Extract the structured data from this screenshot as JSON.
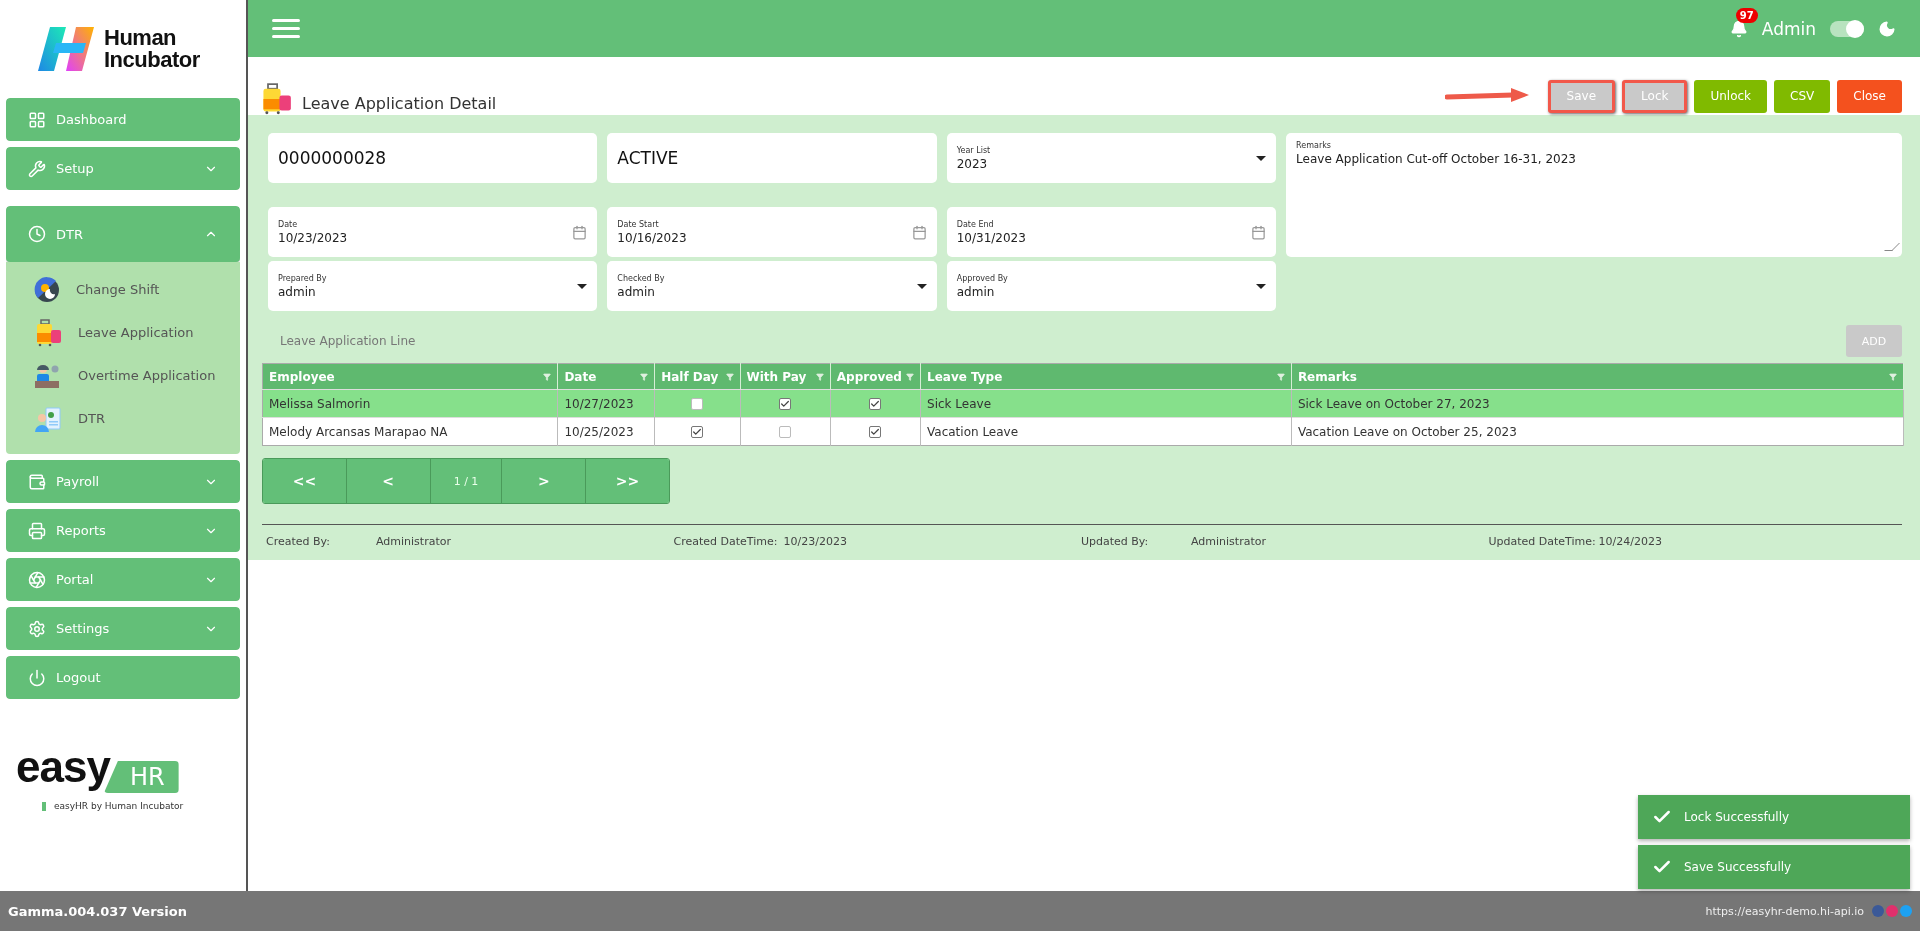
{
  "brand": {
    "line1": "Human",
    "line2": "Incubator"
  },
  "sidebar": {
    "items": [
      {
        "label": "Dashboard",
        "kind": "link"
      },
      {
        "label": "Setup",
        "kind": "group",
        "expanded": false
      },
      {
        "label": "DTR",
        "kind": "group",
        "expanded": true,
        "children": [
          {
            "label": "Change Shift"
          },
          {
            "label": "Leave Application"
          },
          {
            "label": "Overtime Application"
          },
          {
            "label": "DTR"
          }
        ]
      },
      {
        "label": "Payroll",
        "kind": "group",
        "expanded": false
      },
      {
        "label": "Reports",
        "kind": "group",
        "expanded": false
      },
      {
        "label": "Portal",
        "kind": "group",
        "expanded": false
      },
      {
        "label": "Settings",
        "kind": "group",
        "expanded": false
      },
      {
        "label": "Logout",
        "kind": "link"
      }
    ]
  },
  "footer_logo": {
    "word": "easy",
    "badge": "HR",
    "tagline": "easyHR by Human Incubator"
  },
  "header": {
    "notifications": "97",
    "user": "Admin",
    "theme_toggle": {
      "on": true
    }
  },
  "page": {
    "title": "Leave Application Detail",
    "buttons": [
      {
        "label": "Save",
        "kind": "neutral",
        "highlighted": true
      },
      {
        "label": "Lock",
        "kind": "neutral",
        "highlighted": true
      },
      {
        "label": "Unlock",
        "kind": "success",
        "highlighted": false
      },
      {
        "label": "CSV",
        "kind": "success",
        "highlighted": false
      },
      {
        "label": "Close",
        "kind": "danger",
        "highlighted": false
      }
    ]
  },
  "form": {
    "number": "0000000028",
    "status": "ACTIVE",
    "year": {
      "label": "Year List",
      "value": "2023"
    },
    "dates": [
      {
        "label": "Date",
        "value": "10/23/2023"
      },
      {
        "label": "Date Start",
        "value": "10/16/2023"
      },
      {
        "label": "Date End",
        "value": "10/31/2023"
      }
    ],
    "people": [
      {
        "label": "Prepared By",
        "value": "admin"
      },
      {
        "label": "Checked By",
        "value": "admin"
      },
      {
        "label": "Approved By",
        "value": "admin"
      }
    ],
    "remarks": {
      "label": "Remarks",
      "value": "Leave Application Cut-off October 16-31, 2023"
    }
  },
  "lines": {
    "title": "Leave Application Line",
    "add_button": {
      "label": "ADD",
      "disabled": true
    },
    "table": {
      "columns": [
        "Employee",
        "Date",
        "Half Day",
        "With Pay",
        "Approved",
        "Leave Type",
        "Remarks"
      ],
      "rows": [
        {
          "employee": "Melissa Salmorin",
          "date": "10/27/2023",
          "half_day": false,
          "with_pay": true,
          "approved": true,
          "leave_type": "Sick Leave",
          "remarks": "Sick Leave on October 27, 2023",
          "selected": true
        },
        {
          "employee": "Melody Arcansas Marapao NA",
          "date": "10/25/2023",
          "half_day": true,
          "with_pay": false,
          "approved": true,
          "leave_type": "Vacation Leave",
          "remarks": "Vacation Leave on October 25, 2023",
          "selected": false
        }
      ]
    },
    "pagination": [
      "<<",
      "<",
      "1 / 1",
      ">",
      ">>"
    ]
  },
  "audit": [
    {
      "label": "Created By:",
      "value": "Administrator"
    },
    {
      "label": "Created DateTime:",
      "value": "10/23/2023"
    },
    {
      "label": "Updated By:",
      "value": "Administrator"
    },
    {
      "label": "Updated DateTime:",
      "value": "10/24/2023"
    }
  ],
  "toasts": [
    {
      "message": "Lock Successfully"
    },
    {
      "message": "Save Successfully"
    }
  ],
  "status_bar": {
    "version": "Gamma.004.037 Version",
    "url": "https://easyhr-demo.hi-api.io"
  }
}
